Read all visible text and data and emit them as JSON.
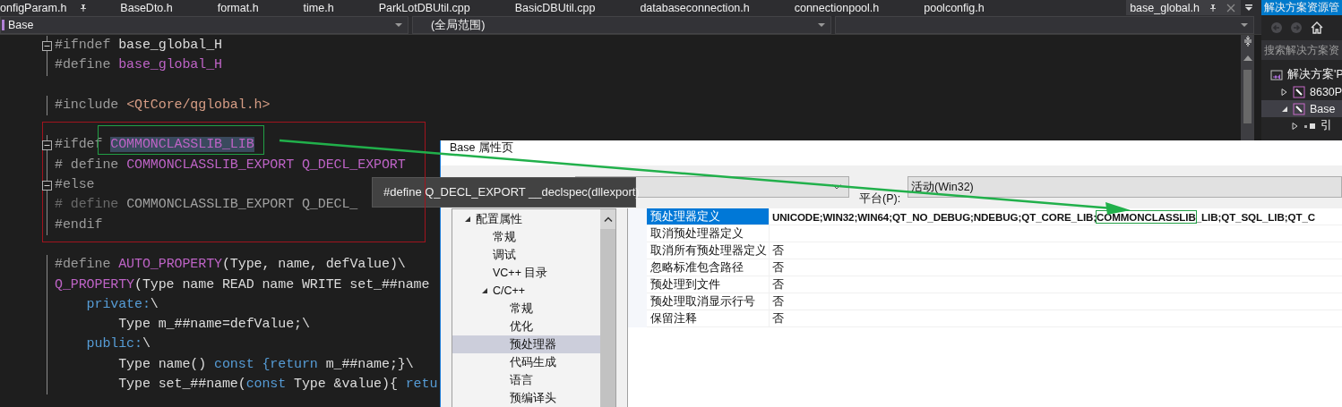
{
  "tabs": [
    {
      "label": "onfigParam.h",
      "selected": false,
      "pinned": true
    },
    {
      "label": "BaseDto.h",
      "selected": false,
      "pinned": false
    },
    {
      "label": "format.h",
      "selected": false,
      "pinned": false
    },
    {
      "label": "time.h",
      "selected": false,
      "pinned": false
    },
    {
      "label": "ParkLotDBUtil.cpp",
      "selected": false,
      "pinned": false
    },
    {
      "label": "BasicDBUtil.cpp",
      "selected": false,
      "pinned": false
    },
    {
      "label": "databaseconnection.h",
      "selected": false,
      "pinned": false
    },
    {
      "label": "connectionpool.h",
      "selected": false,
      "pinned": false
    },
    {
      "label": "poolconfig.h",
      "selected": false,
      "pinned": false
    },
    {
      "label": "base_global.h",
      "selected": true,
      "pinned": true
    }
  ],
  "nav_bar": {
    "project": "Base",
    "scope": "(全局范围)"
  },
  "code_blocks": [
    [
      {
        "foldable": true,
        "tokens": [
          {
            "text": "#ifndef ",
            "kind": "dir"
          },
          {
            "text": "base_global_H",
            "kind": "plain"
          }
        ]
      },
      {
        "foldable": false,
        "tokens": [
          {
            "text": "#define ",
            "kind": "dir"
          },
          {
            "text": "base_global_H",
            "kind": "macro"
          }
        ]
      }
    ],
    [
      {
        "foldable": false,
        "tokens": [
          {
            "text": "#include ",
            "kind": "dir"
          },
          {
            "text": "<QtCore/qglobal.h>",
            "kind": "str"
          }
        ]
      }
    ],
    [
      {
        "foldable": true,
        "tokens": [
          {
            "text": "#ifdef ",
            "kind": "dir"
          },
          {
            "text": "COMMONCLASSLIB_LIB",
            "kind": "sel"
          }
        ]
      },
      {
        "foldable": false,
        "tokens": [
          {
            "text": "# define ",
            "kind": "dir"
          },
          {
            "text": "COMMONCLASSLIB_EXPORT Q_DECL_EXPORT",
            "kind": "macro"
          }
        ]
      },
      {
        "foldable": true,
        "tokens": [
          {
            "text": "#else",
            "kind": "dir"
          }
        ]
      },
      {
        "foldable": false,
        "tokens": [
          {
            "text": "# define ",
            "kind": "dim"
          },
          {
            "text": "COMMONCLASSLIB_EXPORT Q_DECL_",
            "kind": "inactive"
          }
        ]
      },
      {
        "foldable": false,
        "tokens": [
          {
            "text": "#endif",
            "kind": "dir"
          }
        ]
      }
    ],
    [
      {
        "foldable": false,
        "tokens": [
          {
            "text": "#define ",
            "kind": "dir"
          },
          {
            "text": "AUTO_PROPERTY",
            "kind": "macro"
          },
          {
            "text": "(Type, name, defValue)\\",
            "kind": "plain"
          }
        ]
      },
      {
        "foldable": false,
        "tokens": [
          {
            "text": "Q_PROPERTY",
            "kind": "macro"
          },
          {
            "text": "(Type name READ name WRITE set_##name",
            "kind": "plain"
          }
        ]
      },
      {
        "foldable": false,
        "tokens": [
          {
            "text": "    private:",
            "kind": "kw"
          },
          {
            "text": "\\",
            "kind": "plain"
          }
        ]
      },
      {
        "foldable": false,
        "tokens": [
          {
            "text": "        Type m_##name=defValue;\\",
            "kind": "plain"
          }
        ]
      },
      {
        "foldable": false,
        "tokens": [
          {
            "text": "    public:",
            "kind": "kw"
          },
          {
            "text": "\\",
            "kind": "plain"
          }
        ]
      },
      {
        "foldable": false,
        "tokens": [
          {
            "text": "        Type name() ",
            "kind": "plain"
          },
          {
            "text": "const {return",
            "kind": "kw"
          },
          {
            "text": " m_##name;}\\",
            "kind": "plain"
          }
        ]
      },
      {
        "foldable": false,
        "tokens": [
          {
            "text": "        Type set_##name(",
            "kind": "plain"
          },
          {
            "text": "const",
            "kind": "kw"
          },
          {
            "text": " Type &value){ ",
            "kind": "plain"
          },
          {
            "text": "retu",
            "kind": "kw"
          }
        ]
      }
    ]
  ],
  "tooltip": "#define Q_DECL_EXPORT __declspec(dllexport)",
  "solution_explorer": {
    "title": "解决方案资源管",
    "search": {
      "placeholder": "搜索解决方案资"
    },
    "tree": [
      {
        "label": "解决方案'P",
        "kind": "solution",
        "selected": false,
        "children": [
          {
            "label": "8630P",
            "kind": "project",
            "selected": false,
            "expanded": false
          },
          {
            "label": "Base",
            "kind": "project",
            "selected": true,
            "expanded": true,
            "children": [
              {
                "label": "引",
                "kind": "references",
                "selected": false,
                "expanded": false
              }
            ]
          }
        ]
      }
    ]
  },
  "dialog": {
    "title": "Base 属性页",
    "platform_label": "平台(P):",
    "platform": "活动(Win32)",
    "tree": [
      {
        "label": "配置属性",
        "selected": false,
        "expanded": true,
        "children": [
          {
            "label": "常规",
            "selected": false
          },
          {
            "label": "调试",
            "selected": false
          },
          {
            "label": "VC++ 目录",
            "selected": false
          },
          {
            "label": "C/C++",
            "selected": false,
            "expanded": true,
            "children": [
              {
                "label": "常规",
                "selected": false
              },
              {
                "label": "优化",
                "selected": false
              },
              {
                "label": "预处理器",
                "selected": true
              },
              {
                "label": "代码生成",
                "selected": false
              },
              {
                "label": "语言",
                "selected": false
              },
              {
                "label": "预编译头",
                "selected": false
              }
            ]
          }
        ]
      }
    ],
    "properties": [
      {
        "name": "预处理器定义",
        "selected": true,
        "value_parts": [
          {
            "text": "UNICODE;WIN32;WIN64;QT_NO_DEBUG;NDEBUG;QT_CORE_LIB;",
            "boxed": false
          },
          {
            "text": "COMMONCLASSLIB",
            "boxed": true
          },
          {
            "text": "_LIB;QT_SQL_LIB;QT_C",
            "boxed": false
          }
        ]
      },
      {
        "name": "取消预处理器定义",
        "selected": false
      },
      {
        "name": "取消所有预处理器定义",
        "value": "否",
        "selected": false
      },
      {
        "name": "忽略标准包含路径",
        "value": "否",
        "selected": false
      },
      {
        "name": "预处理到文件",
        "value": "否",
        "selected": false
      },
      {
        "name": "预处理取消显示行号",
        "value": "否",
        "selected": false
      },
      {
        "name": "保留注释",
        "value": "否",
        "selected": false
      }
    ]
  }
}
